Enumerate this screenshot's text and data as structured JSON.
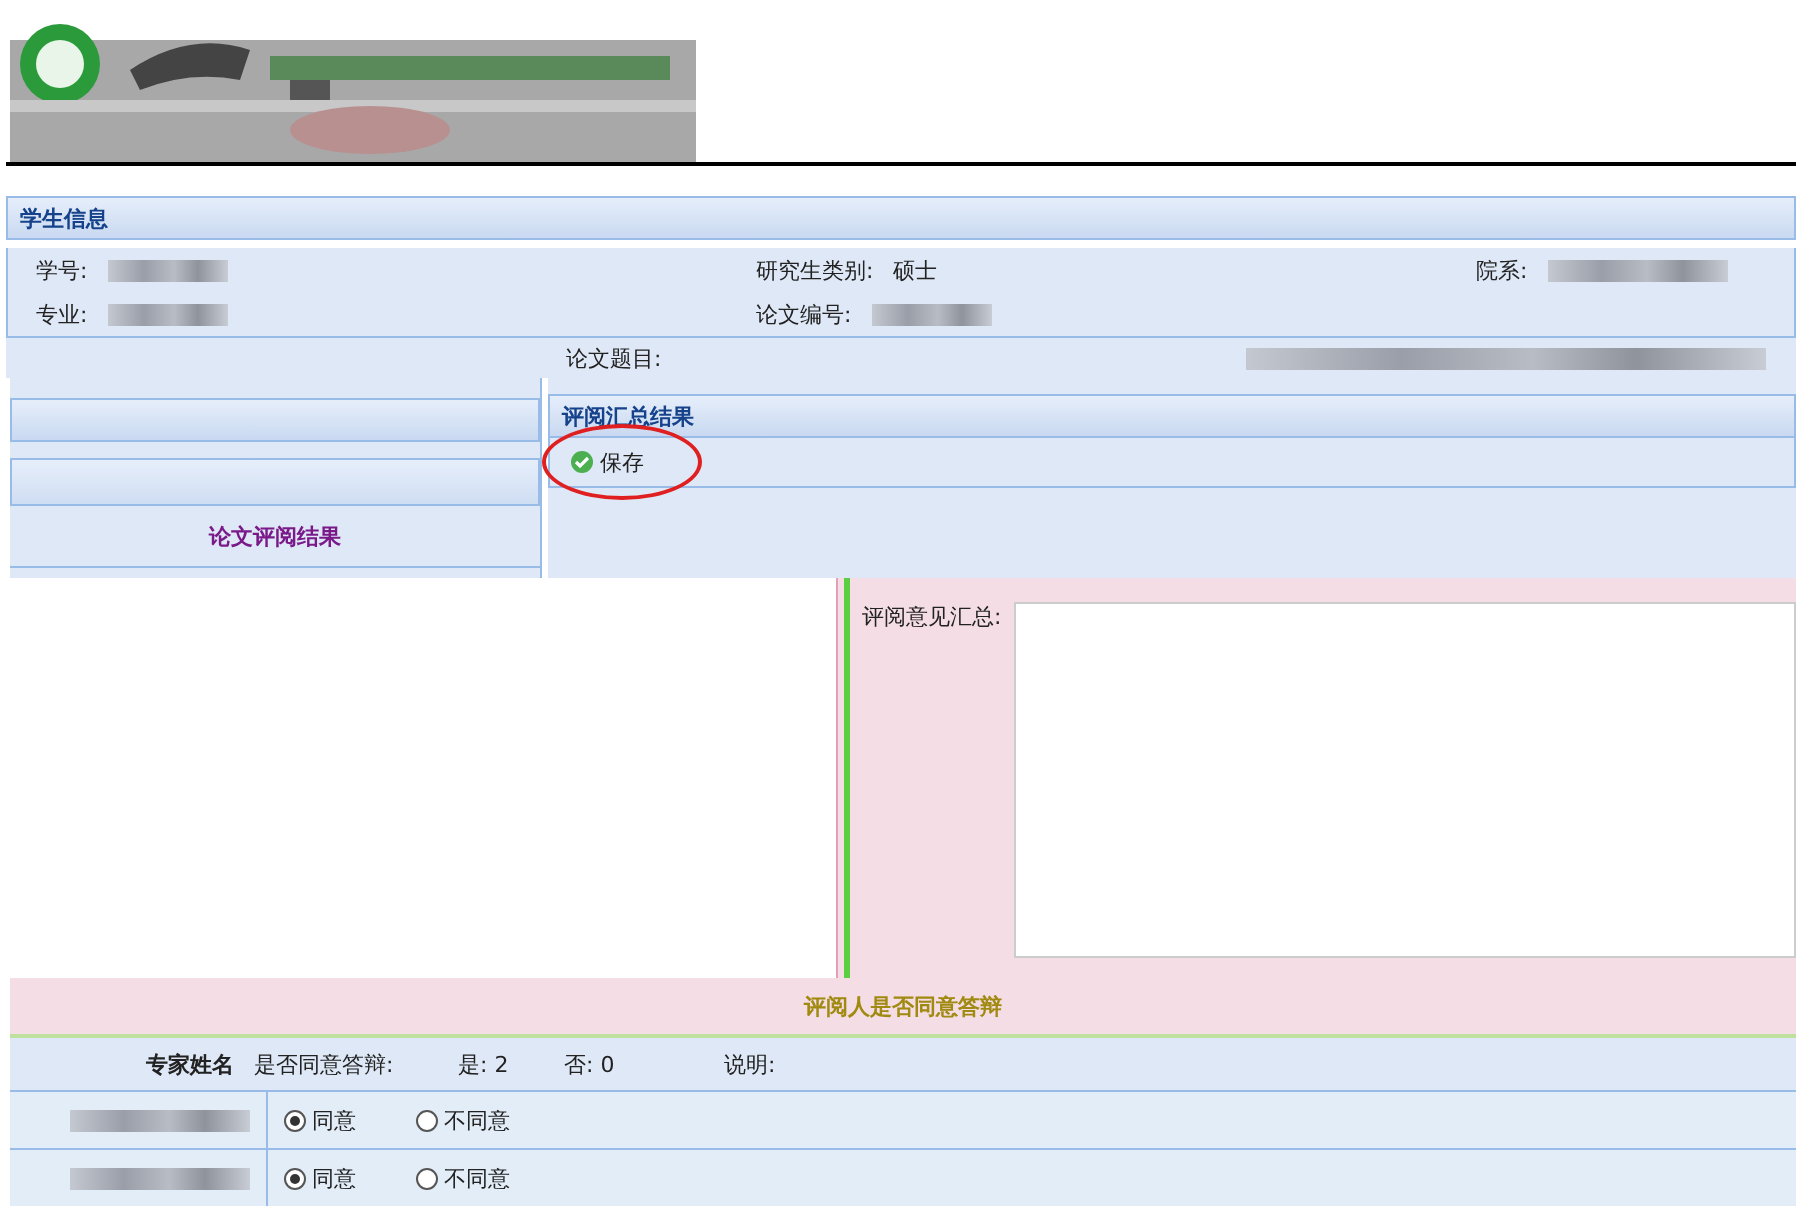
{
  "student_info": {
    "title": "学生信息",
    "fields": [
      {
        "label": "学号:"
      },
      {
        "label": "研究生类别:",
        "value": "硕士"
      },
      {
        "label": "院系:"
      },
      {
        "label": "专业:"
      },
      {
        "label": "论文编号:"
      }
    ],
    "thesis_label": "论文题目:"
  },
  "left_panel": {
    "title": "论文评阅结果"
  },
  "summary": {
    "title": "评阅汇总结果",
    "save_button": "保存",
    "comment_label": "评阅意见汇总:"
  },
  "vote": {
    "title": "评阅人是否同意答辩",
    "columns": {
      "name": "专家姓名",
      "agree_label": "是否同意答辩:",
      "yes_label": "是:",
      "yes_count": "2",
      "no_label": "否:",
      "no_count": "0",
      "note_label": "说明:"
    },
    "rows": [
      {
        "options": [
          {
            "label": "同意",
            "selected": true
          },
          {
            "label": "不同意",
            "selected": false
          }
        ]
      },
      {
        "options": [
          {
            "label": "同意",
            "selected": true
          },
          {
            "label": "不同意",
            "selected": false
          }
        ]
      }
    ]
  }
}
